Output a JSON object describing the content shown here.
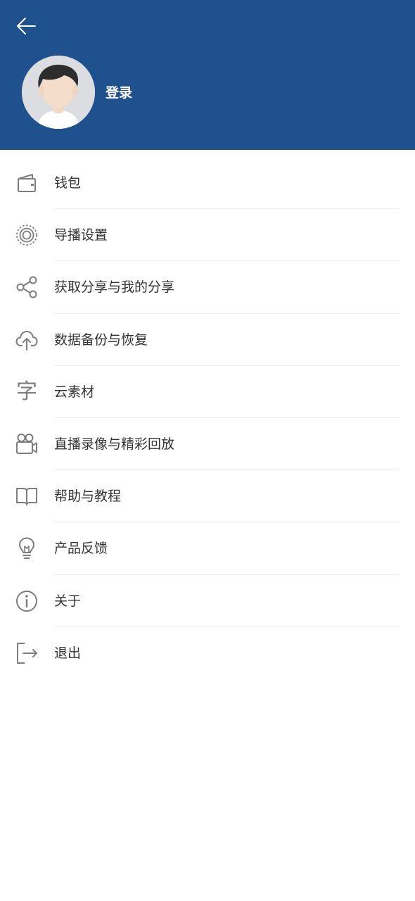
{
  "header": {
    "back_icon": "arrow-left-icon",
    "avatar_icon": "default-avatar-icon",
    "login_label": "登录",
    "background_color": "#20518f"
  },
  "menu": {
    "items": [
      {
        "label": "钱包",
        "icon": "wallet-icon"
      },
      {
        "label": "导播设置",
        "icon": "broadcast-settings-icon"
      },
      {
        "label": "获取分享与我的分享",
        "icon": "share-icon"
      },
      {
        "label": "数据备份与恢复",
        "icon": "cloud-upload-icon"
      },
      {
        "label": "云素材",
        "icon": "character-icon",
        "glyph": "字"
      },
      {
        "label": "直播录像与精彩回放",
        "icon": "video-camera-icon"
      },
      {
        "label": "帮助与教程",
        "icon": "book-icon"
      },
      {
        "label": "产品反馈",
        "icon": "lightbulb-icon"
      },
      {
        "label": "关于",
        "icon": "info-icon"
      },
      {
        "label": "退出",
        "icon": "logout-icon"
      }
    ]
  }
}
